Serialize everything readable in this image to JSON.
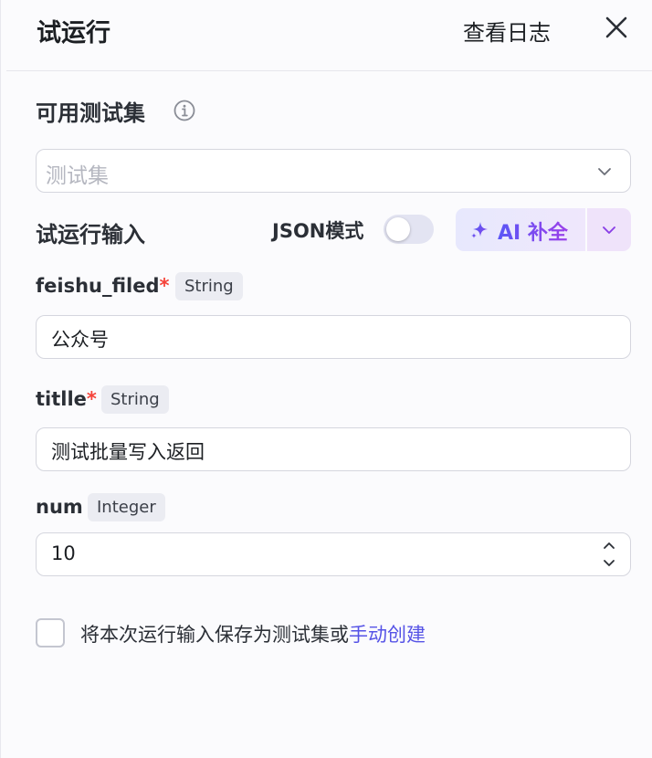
{
  "header": {
    "title": "试运行",
    "view_log": "查看日志"
  },
  "test_set": {
    "label": "可用测试集",
    "placeholder": "测试集"
  },
  "run_input": {
    "label": "试运行输入",
    "json_mode_label": "JSON模式",
    "json_mode_on": false,
    "ai_complete_label": "AI 补全"
  },
  "fields": [
    {
      "name": "feishu_filed",
      "required": "*",
      "type": "String",
      "value": "公众号"
    },
    {
      "name": "titlle",
      "required": "*",
      "type": "String",
      "value": "测试批量写入返回"
    },
    {
      "name": "num",
      "required": "",
      "type": "Integer",
      "value": "10"
    }
  ],
  "save": {
    "text": "将本次运行输入保存为测试集或",
    "link": "手动创建",
    "checked": false
  },
  "colors": {
    "accent": "#5653e6",
    "required": "#f5433a"
  }
}
